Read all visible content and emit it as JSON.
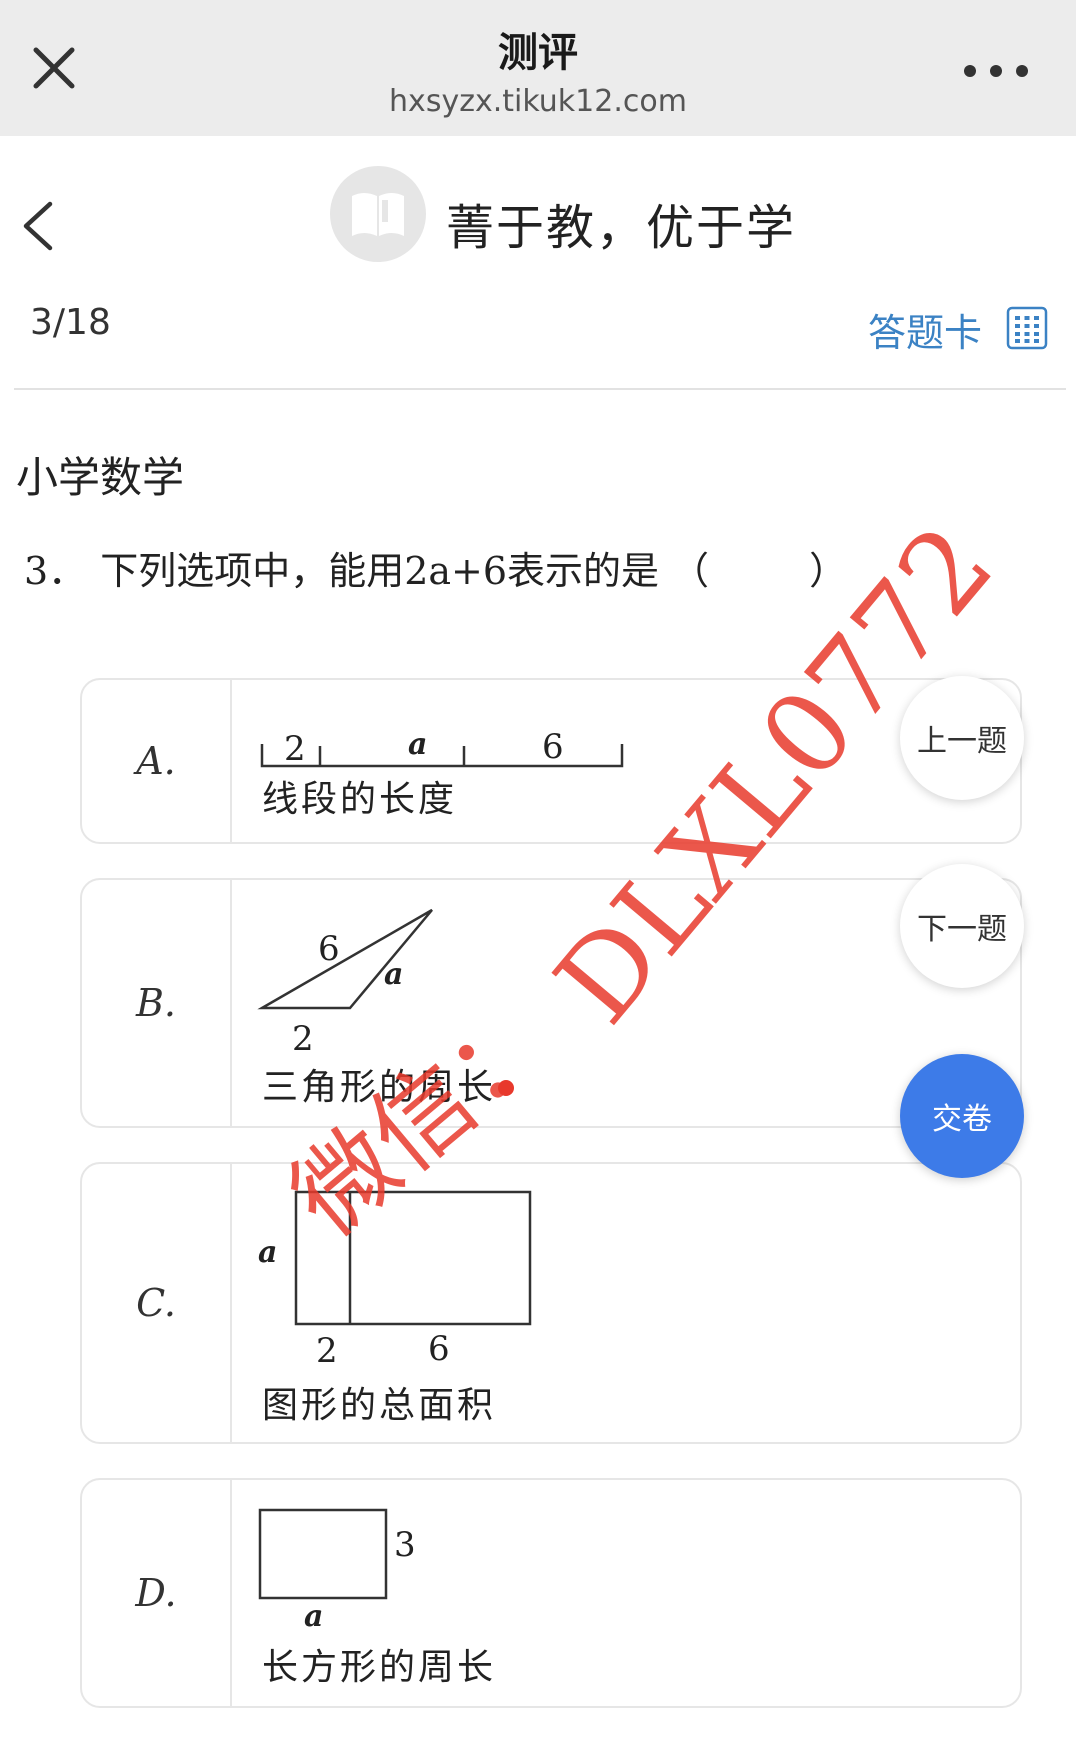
{
  "browser": {
    "title": "测评",
    "url": "hxsyzx.tikuk12.com"
  },
  "header": {
    "slogan": "菁于教，优于学"
  },
  "progress": {
    "text": "3/18",
    "answer_card_label": "答题卡"
  },
  "subject": "小学数学",
  "question": {
    "number": "3．",
    "text": "下列选项中，能用2a+6表示的是",
    "paren_open": "（",
    "paren_close": "）"
  },
  "options": [
    {
      "letter": "A.",
      "caption": "线段的长度",
      "labels": [
        "2",
        "a",
        "6"
      ]
    },
    {
      "letter": "B.",
      "caption": "三角形的周长",
      "labels": [
        "6",
        "a",
        "2"
      ]
    },
    {
      "letter": "C.",
      "caption": "图形的总面积",
      "labels": [
        "a",
        "2",
        "6"
      ]
    },
    {
      "letter": "D.",
      "caption": "长方形的周长",
      "labels": [
        "3",
        "a"
      ]
    }
  ],
  "nav": {
    "prev_label": "上一题",
    "next_label": "下一题",
    "submit_label": "交卷"
  },
  "watermark": {
    "line1": "DLXL0772",
    "line2": "微信：",
    "color": "#e8392c"
  },
  "colors": {
    "accent": "#3b82c4",
    "submit": "#3d7be8",
    "bar": "#ececec"
  }
}
